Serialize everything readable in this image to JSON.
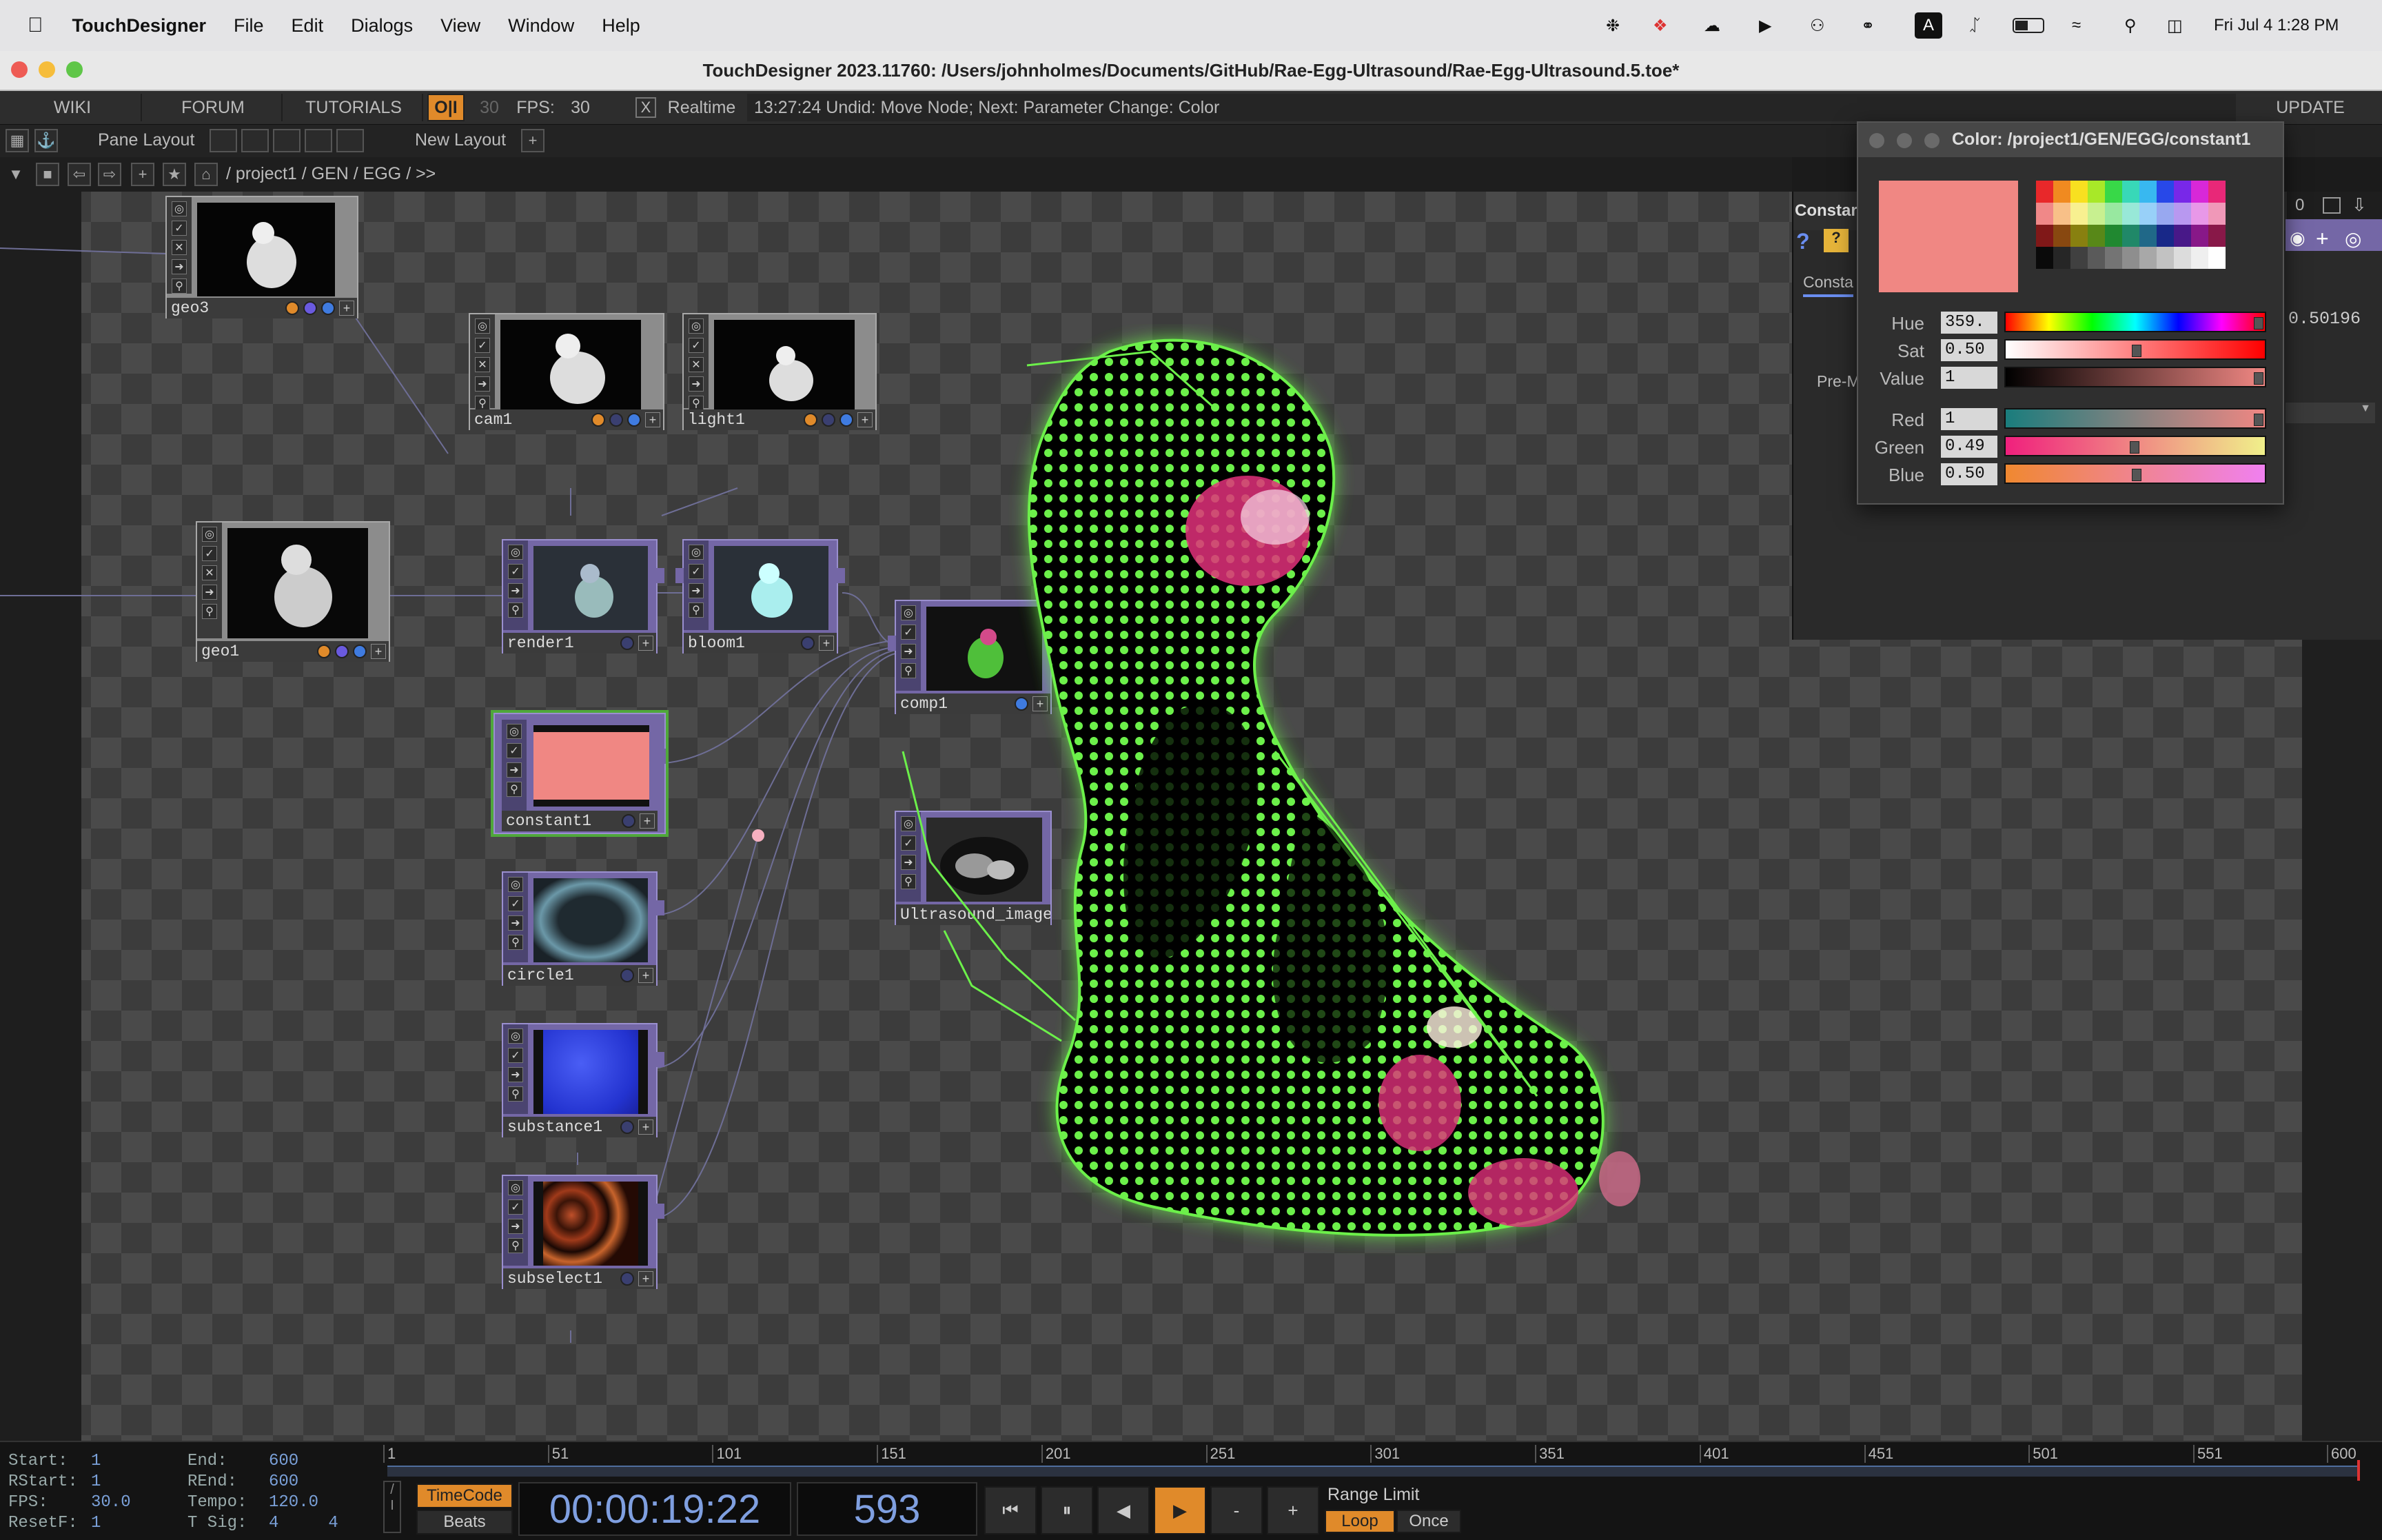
{
  "menubar": {
    "app": "TouchDesigner",
    "items": [
      "File",
      "Edit",
      "Dialogs",
      "View",
      "Window",
      "Help"
    ],
    "clock": "Fri Jul 4  1:28 PM",
    "input_badge": "A"
  },
  "window": {
    "title": "TouchDesigner 2023.11760: /Users/johnholmes/Documents/GitHub/Rae-Egg-Ultrasound/Rae-Egg-Ultrasound.5.toe*"
  },
  "toolbar": {
    "wiki": "WIKI",
    "forum": "FORUM",
    "tutorials": "TUTORIALS",
    "oi": "O|I",
    "fps_target": "30",
    "fps_label": "FPS:",
    "fps_value": "30",
    "realtime_check": "X",
    "realtime": "Realtime",
    "status": "13:27:24 Undid: Move Node; Next: Parameter Change: Color",
    "update": "UPDATE"
  },
  "layoutbar": {
    "pane_layout": "Pane Layout",
    "new_layout": "New Layout",
    "plus": "+"
  },
  "pathbar": {
    "path": "/ project1 / GEN / EGG / >>"
  },
  "nodes": {
    "geo3": "geo3",
    "cam1": "cam1",
    "light1": "light1",
    "geo1": "geo1",
    "render1": "render1",
    "bloom1": "bloom1",
    "comp1": "comp1",
    "constant1": "constant1",
    "ultrasound": "Ultrasound_image",
    "circle1": "circle1",
    "substance1": "substance1",
    "subselect1": "subselect1"
  },
  "colors": {
    "constant": "#f08783",
    "accent_orange": "#e08a2a",
    "neon_green": "#6cf04a",
    "magenta": "#e0307a"
  },
  "params": {
    "op_label": "Constar",
    "tab": "Consta",
    "premult": "Pre-M",
    "value_right": "0.50196",
    "counter": "0"
  },
  "color_dialog": {
    "title": "Color:  /project1/GEN/EGG/constant1",
    "hue_label": "Hue",
    "hue_value": "359.",
    "sat_label": "Sat",
    "sat_value": "0.50",
    "val_label": "Value",
    "val_value": "1",
    "red_label": "Red",
    "red_value": "1",
    "green_label": "Green",
    "green_value": "0.49",
    "blue_label": "Blue",
    "blue_value": "0.50"
  },
  "timeline": {
    "start_k": "Start:",
    "start_v": "1",
    "end_k": "End:",
    "end_v": "600",
    "rstart_k": "RStart:",
    "rstart_v": "1",
    "rend_k": "REnd:",
    "rend_v": "600",
    "fps_k": "FPS:",
    "fps_v": "30.0",
    "tempo_k": "Tempo:",
    "tempo_v": "120.0",
    "resetf_k": "ResetF:",
    "resetf_v": "1",
    "tsig_k": "T Sig:",
    "tsig_v": "4     4",
    "ticks": [
      "1",
      "51",
      "101",
      "151",
      "201",
      "251",
      "301",
      "351",
      "401",
      "451",
      "501",
      "551",
      "600"
    ],
    "timecode_btn": "TimeCode",
    "beats_btn": "Beats",
    "timecode": "00:00:19:22",
    "frame": "593",
    "range_limit": "Range Limit",
    "loop": "Loop",
    "once": "Once",
    "minus": "-",
    "plus": "+"
  }
}
